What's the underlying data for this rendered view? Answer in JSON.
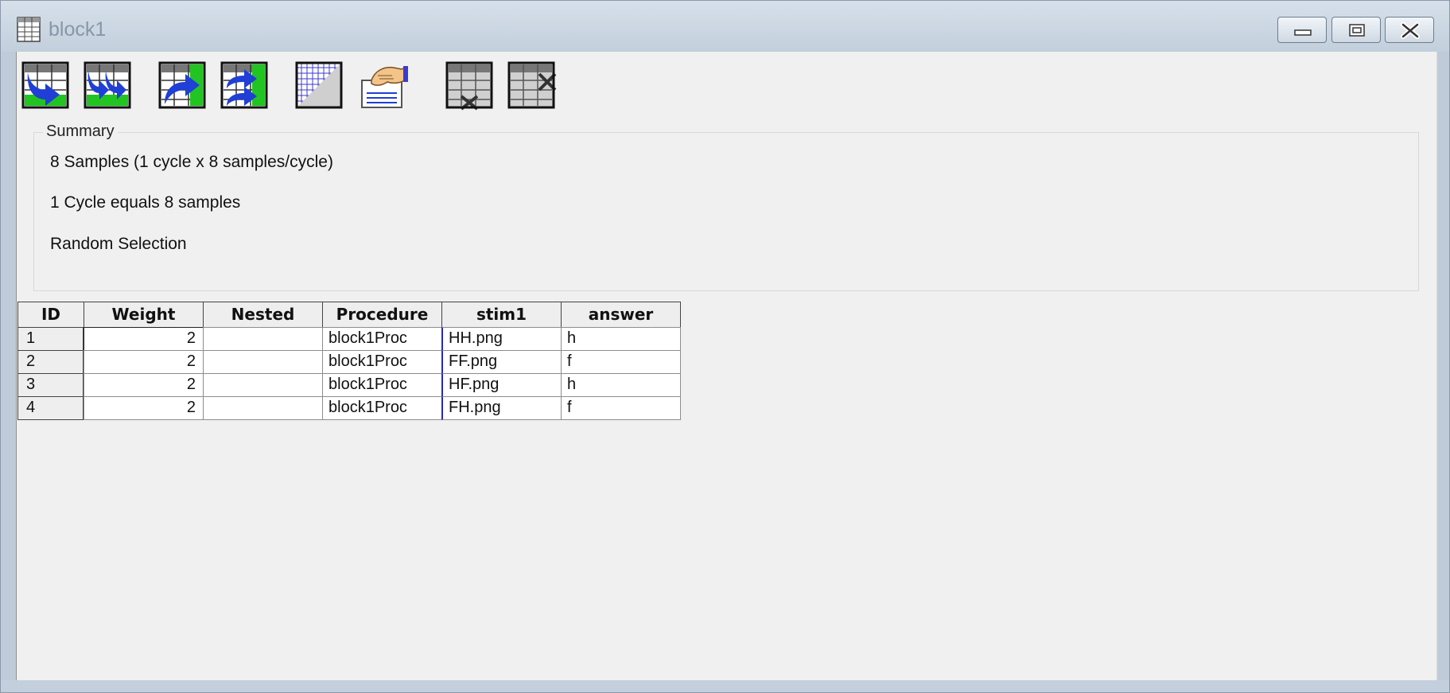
{
  "window": {
    "title": "block1"
  },
  "toolbar": {
    "buttons": [
      {
        "name": "add-level-icon"
      },
      {
        "name": "add-multiple-levels-icon"
      },
      {
        "name": "add-attribute-icon"
      },
      {
        "name": "add-multiple-attributes-icon"
      },
      {
        "name": "grid-properties-icon"
      },
      {
        "name": "summary-properties-icon"
      },
      {
        "name": "remove-level-icon"
      },
      {
        "name": "remove-attribute-icon"
      }
    ]
  },
  "summary": {
    "label": "Summary",
    "lines": [
      "8 Samples (1 cycle x 8 samples/cycle)",
      "1 Cycle equals 8 samples",
      "Random Selection"
    ]
  },
  "table": {
    "headers": [
      "ID",
      "Weight",
      "Nested",
      "Procedure",
      "stim1",
      "answer"
    ],
    "rows": [
      [
        "1",
        "2",
        "",
        "block1Proc",
        "HH.png",
        "h"
      ],
      [
        "2",
        "2",
        "",
        "block1Proc",
        "FF.png",
        "f"
      ],
      [
        "3",
        "2",
        "",
        "block1Proc",
        "HF.png",
        "h"
      ],
      [
        "4",
        "2",
        "",
        "block1Proc",
        "FH.png",
        "f"
      ]
    ]
  },
  "colors": {
    "accent_blue": "#1f3fd6",
    "grid_green": "#21c421",
    "frame": "#bfcbd9"
  }
}
